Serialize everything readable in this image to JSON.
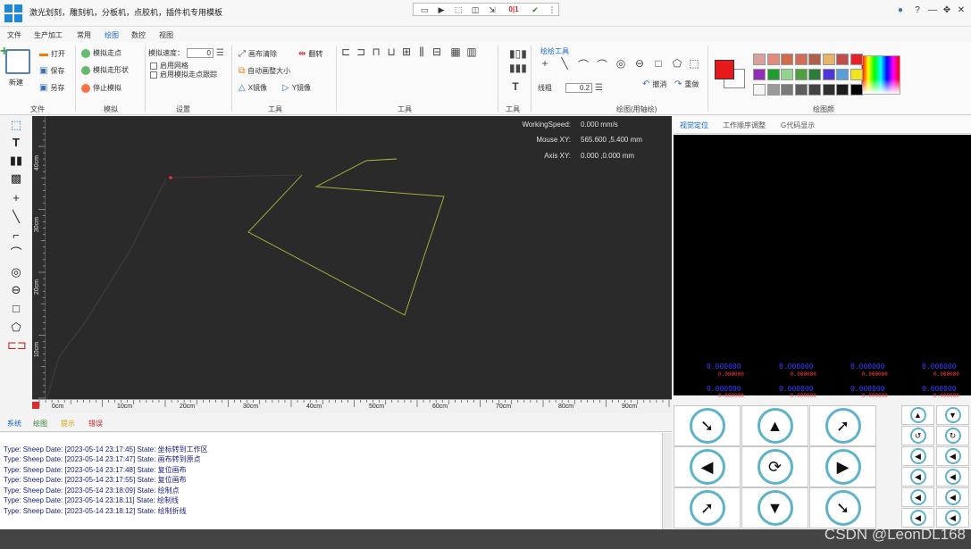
{
  "app": {
    "title": "激光划刻，雕刻机，分板机，点胶机，插件机专用模板",
    "quickbar_badge": "0|1"
  },
  "menu": [
    "文件",
    "生产加工",
    "常用",
    "绘图",
    "数控",
    "视图"
  ],
  "menu_active": "绘图",
  "ribbon": {
    "file": {
      "new": "新建",
      "open": "打开",
      "save": "保存",
      "save_as": "另存",
      "group": "文件"
    },
    "simulate": {
      "walk_point": "模拟走点",
      "walk_shape": "模拟走形状",
      "stop": "停止模拟",
      "group": "模拟"
    },
    "settings": {
      "speed_label": "模拟速度：",
      "speed_value": "0",
      "grid": "启用网格",
      "trace": "启用模拟走点跟踪",
      "group": "设置"
    },
    "tools": {
      "clear_canvas": "画布清除",
      "auto_fit": "自动画整大小",
      "mirror_x": "X镜像",
      "mirror_y": "Y镜像",
      "flip": "翻转",
      "group": "工具"
    },
    "tools2": {
      "group": "工具"
    },
    "tools3": {
      "group": "工具"
    },
    "draw": {
      "header": "绘绘工具",
      "line_width_label": "线粗",
      "line_width": "0.2",
      "undo": "撤消",
      "redo": "重做",
      "group": "绘图(用轴绘)"
    },
    "palette": {
      "group": "绘图颜"
    }
  },
  "palette_colors": [
    "#d9a0a0",
    "#e08b7d",
    "#d2694a",
    "#d46b58",
    "#b05f4b",
    "#e6b56a",
    "#c24d4d",
    "#e8202a",
    "#8f2fb5",
    "#1f9d2f",
    "#93d38c",
    "#4aa13d",
    "#2a7d3b",
    "#4d35d8",
    "#5aa0d8",
    "#f1e31d",
    "#f4f4f4",
    "#9a9a9a",
    "#7a7a7a",
    "#5c5c5c",
    "#434343",
    "#2f2f2f",
    "#1c1c1c",
    "#000000"
  ],
  "toolbox": [
    "select-tool",
    "text-tool",
    "barcode-tool",
    "qrcode-tool",
    "point-tool",
    "line-tool",
    "polyline-tool",
    "arc-tool",
    "circle-tool",
    "ellipse-tool",
    "rectangle-tool",
    "polygon-tool",
    "marker-tool"
  ],
  "canvas": {
    "working_speed_label": "WorkingSpeed:",
    "working_speed": "0.000 mm/s",
    "mouse_label": "Mouse XY:",
    "mouse_value": "565.600 ,5.400 mm",
    "axis_label": "Axis XY:",
    "axis_value": "0.000 ,0.000 mm",
    "h_ruler": [
      "0cm",
      "10cm",
      "20cm",
      "30cm",
      "40cm",
      "50cm",
      "60cm",
      "70cm",
      "80cm",
      "90cm"
    ],
    "v_ruler": [
      "40cm",
      "30cm",
      "20cm",
      "10cm"
    ]
  },
  "right_panel": {
    "tabs": [
      "视觉定位",
      "工作顺序调整",
      "G代码显示"
    ],
    "active_tab": "视觉定位",
    "coords_blue": "0.000000",
    "coords_red": "0.000000"
  },
  "log": {
    "tabs": [
      "系统",
      "绘图",
      "提示",
      "错误"
    ],
    "lines": [
      "Type: Sheep  Date: [2023-05-14 23:17:45]  State: 坐标转到工作区",
      "Type: Sheep  Date: [2023-05-14 23:17:47]  State: 画布转到原点",
      "Type: Sheep  Date: [2023-05-14 23:17:48]  State: 复位画布",
      "Type: Sheep  Date: [2023-05-14 23:17:55]  State: 复位画布",
      "Type: Sheep  Date: [2023-05-14 23:18:09]  State: 绘制点",
      "Type: Sheep  Date: [2023-05-14 23:18:11]  State: 绘制线",
      "Type: Sheep  Date: [2023-05-14 23:18:12]  State: 绘制折线"
    ]
  },
  "watermark": "CSDN @LeonDL168"
}
